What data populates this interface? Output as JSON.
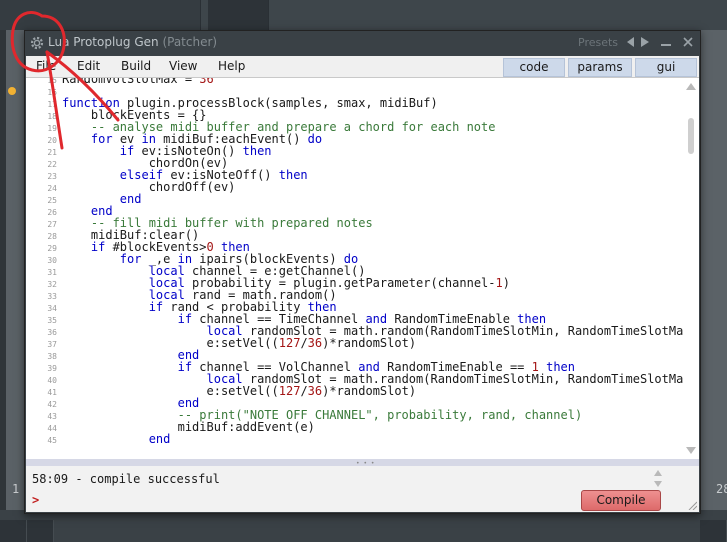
{
  "host": {
    "side_number_left": "1",
    "side_number_right": "28"
  },
  "window": {
    "title": "Lua Protoplug Gen",
    "subtitle": "(Patcher)",
    "presets_label": "Presets",
    "prev_icon": "triangle-left-icon",
    "next_icon": "triangle-right-icon",
    "minimize_icon": "minimize-icon",
    "close_icon": "close-icon"
  },
  "menu": {
    "items": [
      "File",
      "Edit",
      "Build",
      "View",
      "Help"
    ],
    "tabs": [
      "code",
      "params",
      "gui"
    ]
  },
  "editor": {
    "line_numbers": [
      "15",
      "16",
      "17",
      "18",
      "19",
      "20",
      "21",
      "22",
      "23",
      "24",
      "25",
      "26",
      "27",
      "28",
      "29",
      "30",
      "31",
      "32",
      "33",
      "34",
      "35",
      "36",
      "37",
      "38",
      "39",
      "40",
      "41",
      "42",
      "43",
      "44",
      "45"
    ],
    "lines": [
      "RandomVolSlotMax = 36",
      "",
      "function plugin.processBlock(samples, smax, midiBuf)",
      "    blockEvents = {}",
      "    -- analyse midi buffer and prepare a chord for each note",
      "    for ev in midiBuf:eachEvent() do",
      "        if ev:isNoteOn() then",
      "            chordOn(ev)",
      "        elseif ev:isNoteOff() then",
      "            chordOff(ev)",
      "        end",
      "    end",
      "    -- fill midi buffer with prepared notes",
      "    midiBuf:clear()",
      "    if #blockEvents>0 then",
      "        for _,e in ipairs(blockEvents) do",
      "            local channel = e:getChannel()",
      "            local probability = plugin.getParameter(channel-1)",
      "            local rand = math.random()",
      "            if rand < probability then",
      "                if channel == TimeChannel and RandomTimeEnable then",
      "                    local randomSlot = math.random(RandomTimeSlotMin, RandomTimeSlotMa",
      "                    e:setVel((127/36)*randomSlot)",
      "                end",
      "                if channel == VolChannel and RandomTimeEnable == 1 then",
      "                    local randomSlot = math.random(RandomTimeSlotMin, RandomTimeSlotMa",
      "                    e:setVel((127/36)*randomSlot)",
      "                end",
      "                -- print(\"NOTE OFF CHANNEL\", probability, rand, channel)",
      "                midiBuf:addEvent(e)",
      "            end"
    ]
  },
  "console": {
    "message": "58:09 - compile successful",
    "prompt": ">",
    "compile_label": "Compile"
  },
  "colors": {
    "keyword": "#0000c8",
    "comment": "#3a7a3a",
    "number": "#a31515",
    "annotation": "#e0282d",
    "compile_button": "#e07a7a"
  }
}
